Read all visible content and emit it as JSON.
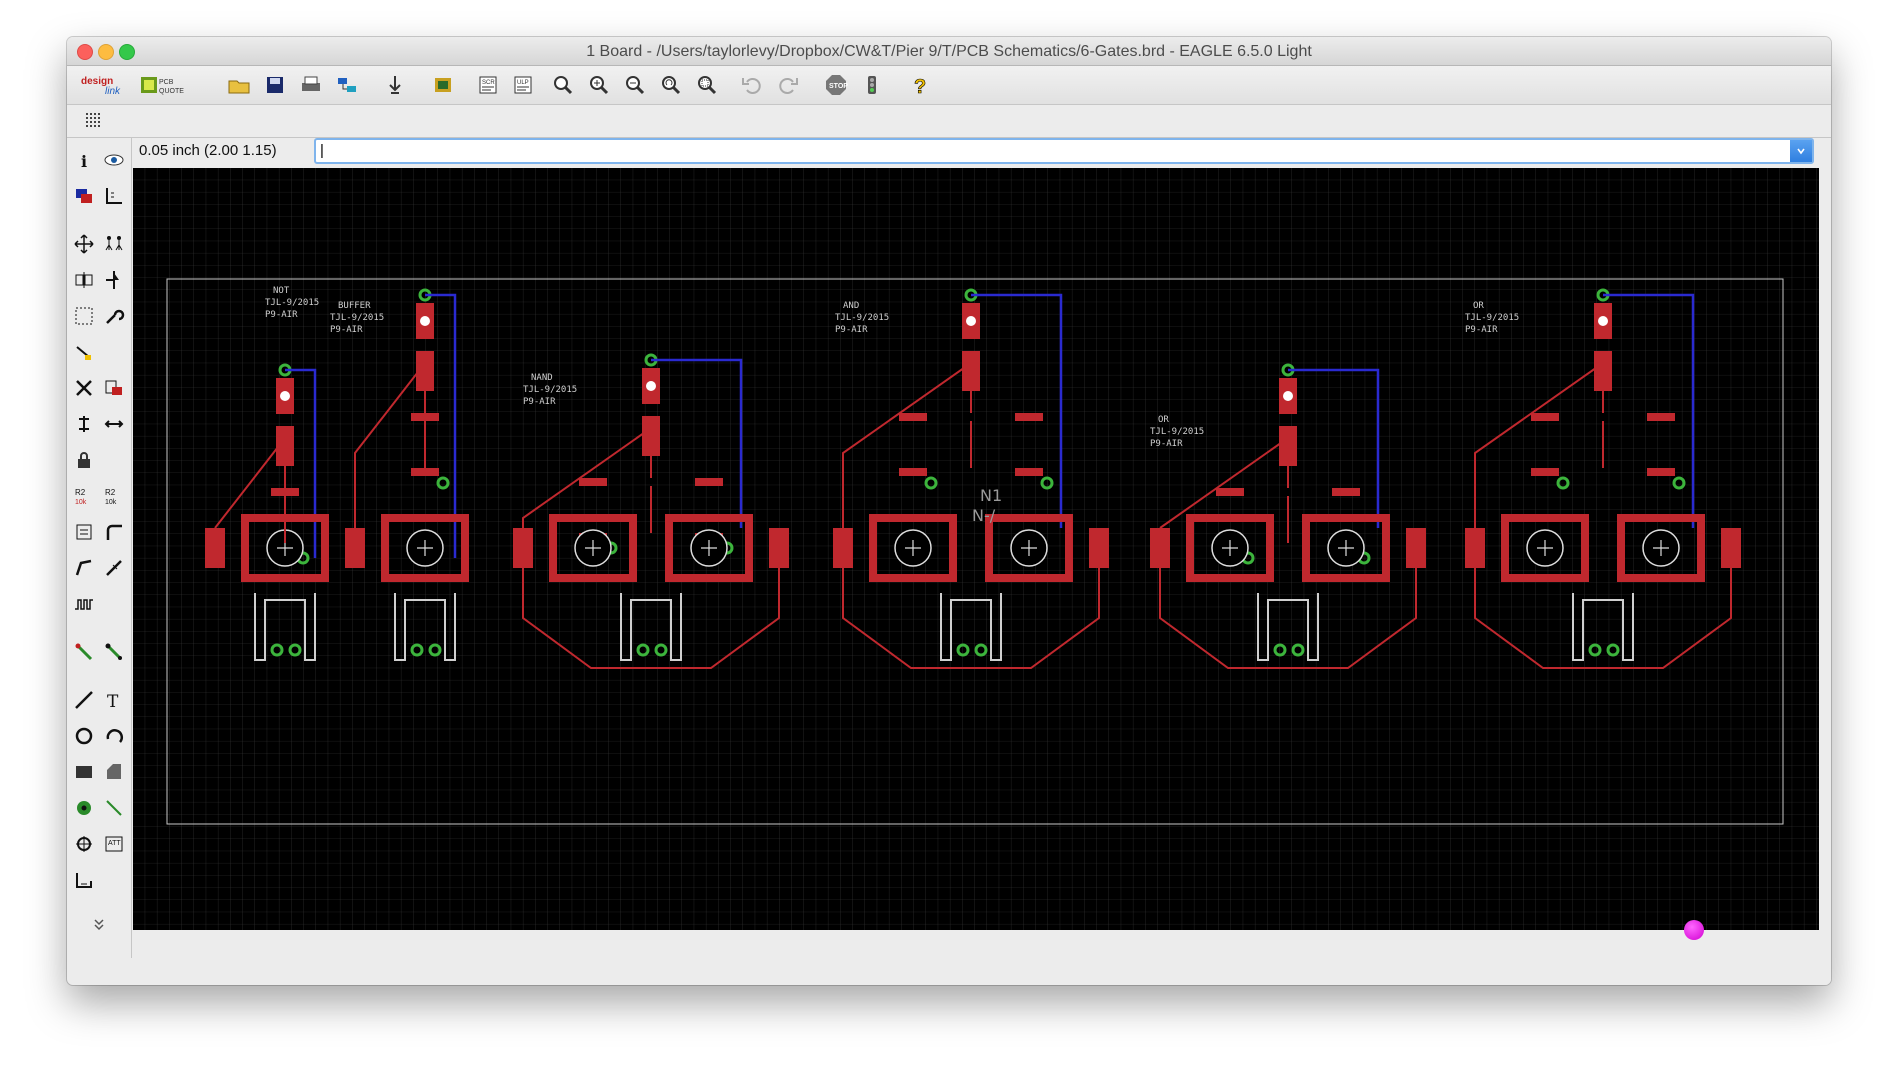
{
  "window": {
    "title": "1 Board - /Users/taylorlevy/Dropbox/CW&T/Pier 9/T/PCB Schematics/6-Gates.brd - EAGLE 6.5.0 Light"
  },
  "toolbar": {
    "buttons": [
      "designlink-icon",
      "pcb-quote-icon",
      "open-icon",
      "save-icon",
      "print-icon",
      "cam-icon",
      "import-icon",
      "board-icon",
      "script-icon",
      "ulp-icon",
      "zoom-fit-icon",
      "zoom-in-icon",
      "zoom-out-icon",
      "zoom-redraw-icon",
      "zoom-select-icon",
      "undo-icon",
      "redo-icon",
      "stop-icon",
      "go-icon",
      "help-icon"
    ],
    "designlink_label": "design link",
    "pcbquote_label": "PCB QUOTE"
  },
  "command": {
    "coordinate": "0.05 inch (2.00 1.15)",
    "value": "|",
    "placeholder": ""
  },
  "board": {
    "gates": [
      {
        "name": "NOT",
        "date": "TJL-9/2015",
        "code": "P9-AIR"
      },
      {
        "name": "BUFFER",
        "date": "TJL-9/2015",
        "code": "P9-AIR"
      },
      {
        "name": "NAND",
        "date": "TJL-9/2015",
        "code": "P9-AIR"
      },
      {
        "name": "AND",
        "date": "TJL-9/2015",
        "code": "P9-AIR"
      },
      {
        "name": "OR",
        "date": "TJL-9/2015",
        "code": "P9-AIR"
      },
      {
        "name": "OR",
        "date": "TJL-9/2015",
        "code": "P9-AIR"
      }
    ],
    "part_labels": {
      "n1": "N1",
      "n_slash": "N-/"
    },
    "colors": {
      "top_copper": "#c0282e",
      "bottom_copper": "#2a2ad0",
      "via": "#3cb43c",
      "grid": "#333333",
      "outline": "#c8c8c8"
    }
  },
  "status": {
    "indicator_color": "#e000e0"
  }
}
